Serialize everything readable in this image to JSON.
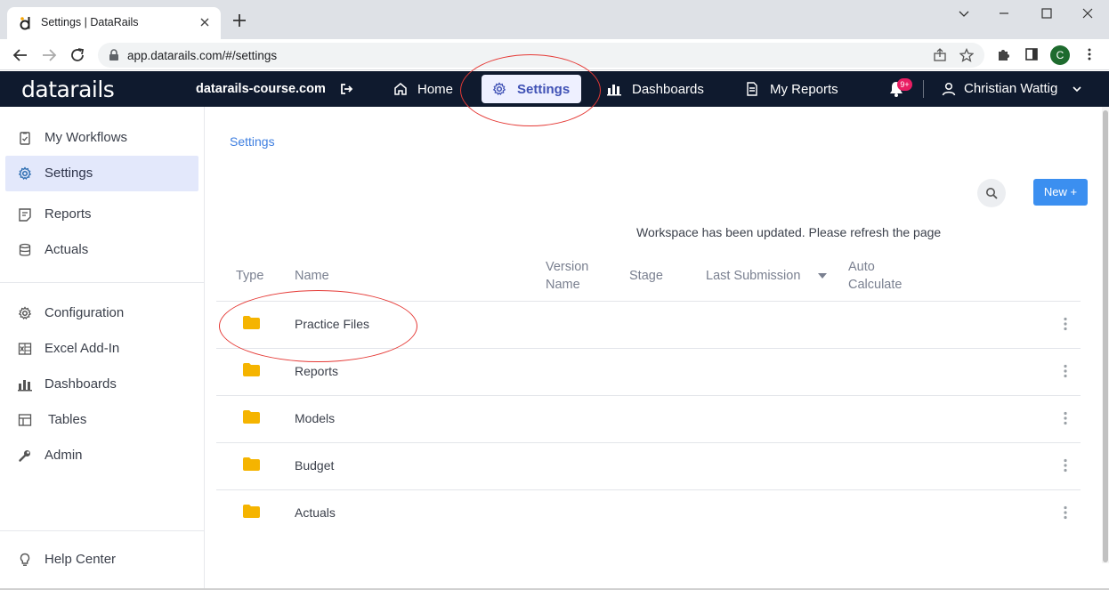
{
  "browser": {
    "tab_title": "Settings | DataRails",
    "url": "app.datarails.com/#/settings",
    "profile_initial": "C"
  },
  "header": {
    "logo": "datarails",
    "workspace": "datarails-course.com",
    "nav": [
      {
        "label": "Home",
        "icon": "home-icon"
      },
      {
        "label": "Settings",
        "icon": "gear-icon"
      },
      {
        "label": "Dashboards",
        "icon": "bar-chart-icon"
      },
      {
        "label": "My Reports",
        "icon": "document-icon"
      }
    ],
    "notification_badge": "9+",
    "user_name": "Christian Wattig"
  },
  "sidebar": {
    "items": [
      {
        "label": "My Workflows",
        "icon": "clipboard-icon"
      },
      {
        "label": "Settings",
        "icon": "gear-icon"
      },
      {
        "label": "Reports",
        "icon": "report-icon"
      },
      {
        "label": "Actuals",
        "icon": "database-icon"
      },
      {
        "label": "Configuration",
        "icon": "gear-icon"
      },
      {
        "label": "Excel Add-In",
        "icon": "excel-icon"
      },
      {
        "label": "Dashboards",
        "icon": "bar-chart-icon"
      },
      {
        "label": "Tables",
        "icon": "table-icon"
      },
      {
        "label": "Admin",
        "icon": "wrench-icon"
      }
    ],
    "help": {
      "label": "Help Center",
      "icon": "lightbulb-icon"
    }
  },
  "main": {
    "breadcrumb": "Settings",
    "new_button": "New +",
    "notice": "Workspace has been updated. Please refresh the page",
    "columns": {
      "type": "Type",
      "name": "Name",
      "version_1": "Version",
      "version_2": "Name",
      "stage": "Stage",
      "last_submission": "Last Submission",
      "auto_1": "Auto",
      "auto_2": "Calculate"
    },
    "rows": [
      {
        "name": "Practice Files"
      },
      {
        "name": "Reports"
      },
      {
        "name": "Models"
      },
      {
        "name": "Budget"
      },
      {
        "name": "Actuals"
      }
    ]
  },
  "colors": {
    "header_bg": "#0f1a2e",
    "accent": "#3f51b5",
    "new_button": "#3b8ff0",
    "folder": "#f5b400",
    "annotation": "#e53935"
  }
}
